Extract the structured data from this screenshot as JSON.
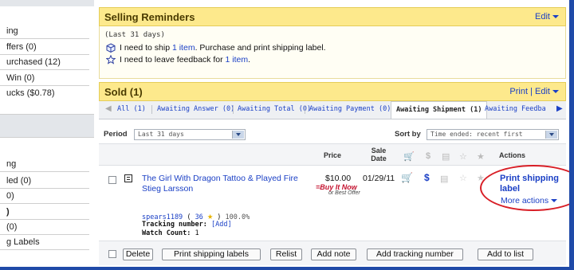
{
  "sidebar": {
    "items_top": [
      "ing",
      "ffers (0)",
      "urchased (12)",
      "Win (0)",
      "ucks ($0.78)"
    ],
    "items_bottom": [
      "ng",
      "led (0)",
      "0)",
      ")",
      "(0)",
      "g Labels"
    ]
  },
  "reminders": {
    "title": "Selling Reminders",
    "edit_label": "Edit",
    "period": "(Last 31 days)",
    "line1_prefix": "I need to ship ",
    "line1_link": "1 item",
    "line1_suffix": ". Purchase and print shipping label.",
    "line2_prefix": "I need to leave feedback for ",
    "line2_link": "1 item",
    "line2_suffix": "."
  },
  "sold": {
    "title": "Sold (1)",
    "print_label": "Print",
    "edit_label": "Edit",
    "tabs": [
      "All (1)",
      "Awaiting Answer (0)",
      "Awaiting Total (0)",
      "Awaiting Payment (0)",
      "Awaiting Shipment (1)",
      "Awaiting Feedba"
    ],
    "period_label": "Period",
    "period_value": "Last 31 days",
    "sortby_label": "Sort by",
    "sortby_value": "Time ended: recent first"
  },
  "table": {
    "headers": {
      "price": "Price",
      "sale_date": "Sale Date",
      "actions": "Actions"
    },
    "row": {
      "title": "The Girl With Dragon Tattoo & Played Fire Stieg Larsson",
      "price": "$10.00",
      "buy_it_now": "=Buy It Now",
      "best_offer": "or Best Offer",
      "sale_date": "01/29/11",
      "action_primary": "Print shipping label",
      "more_actions": "More actions",
      "buyer": "spears1189",
      "feedback_score": "36",
      "feedback_pct": "100.0%",
      "tracking_label": "Tracking number:",
      "tracking_add": "[Add]",
      "watch_label": "Watch Count:",
      "watch_value": "1"
    }
  },
  "buttons": {
    "delete": "Delete",
    "print_labels": "Print shipping labels",
    "relist": "Relist",
    "add_note": "Add note",
    "add_tracking": "Add tracking number",
    "add_to_list": "Add to list"
  },
  "colors": {
    "accent": "#1a3fc5",
    "panel": "#fde98c",
    "frame": "#1f4aa8",
    "highlight": "#d81e26"
  }
}
